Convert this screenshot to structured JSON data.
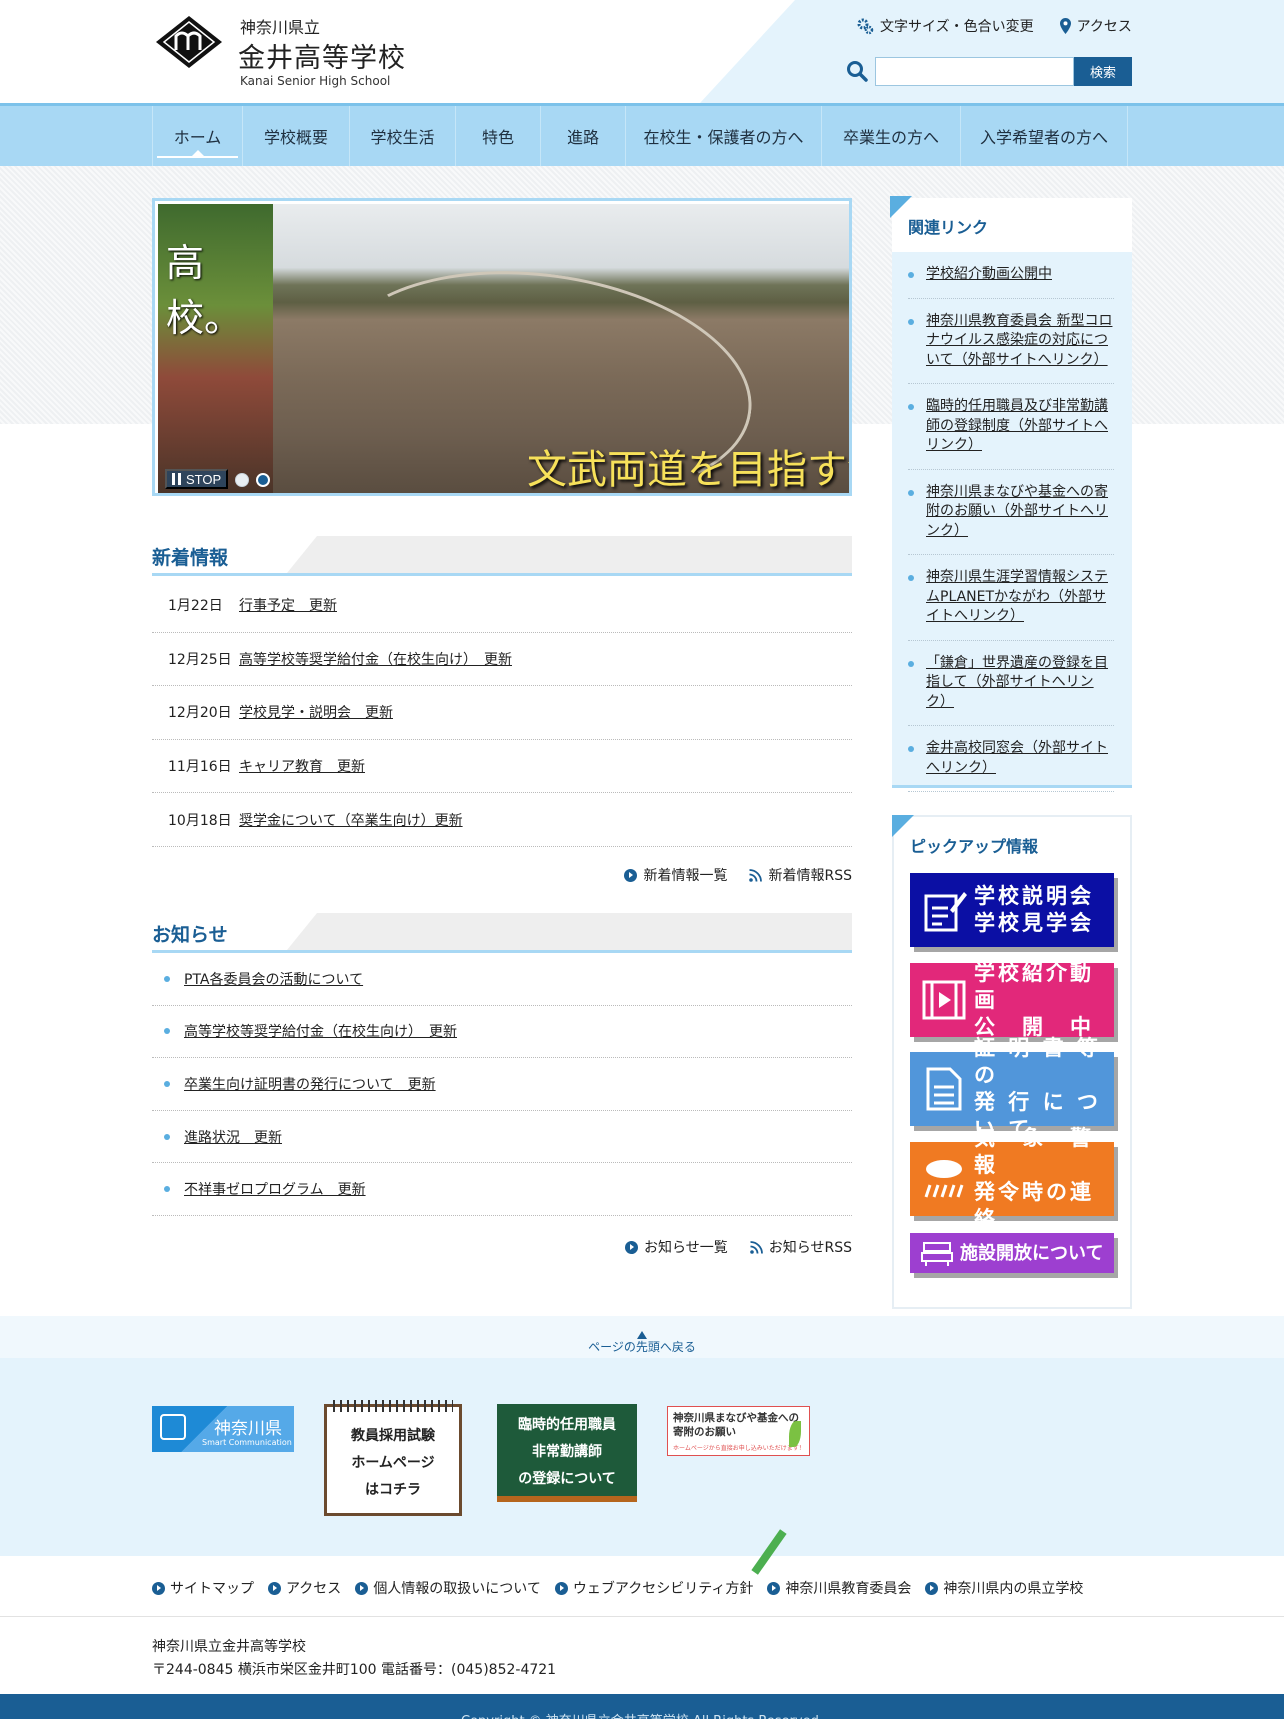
{
  "header": {
    "prefecture": "神奈川県立",
    "school_name": "金井高等学校",
    "school_name_en": "Kanai Senior High School",
    "util_links": [
      {
        "label": "文字サイズ・色合い変更",
        "icon": "gears-icon"
      },
      {
        "label": "アクセス",
        "icon": "map-pin-icon"
      }
    ],
    "search": {
      "placeholder": "",
      "button_label": "検索"
    }
  },
  "nav": {
    "items": [
      {
        "label": "ホーム",
        "active": true
      },
      {
        "label": "学校概要"
      },
      {
        "label": "学校生活"
      },
      {
        "label": "特色"
      },
      {
        "label": "進路"
      },
      {
        "label": "在校生・保護者の方へ"
      },
      {
        "label": "卒業生の方へ"
      },
      {
        "label": "入学希望者の方へ"
      }
    ]
  },
  "slider": {
    "left_text": "高校。",
    "caption": "文武両道を目指す金井",
    "stop_label": "STOP",
    "slide_count": 2,
    "active_slide": 2
  },
  "news": {
    "title": "新着情報",
    "items": [
      {
        "date": "1月22日",
        "title": "行事予定　更新"
      },
      {
        "date": "12月25日",
        "title": "高等学校等奨学給付金（在校生向け）　更新"
      },
      {
        "date": "12月20日",
        "title": "学校見学・説明会　更新"
      },
      {
        "date": "11月16日",
        "title": "キャリア教育　更新"
      },
      {
        "date": "10月18日",
        "title": "奨学金について（卒業生向け）更新"
      }
    ],
    "list_link": "新着情報一覧",
    "rss_link": "新着情報RSS"
  },
  "notices": {
    "title": "お知らせ",
    "items": [
      "PTA各委員会の活動について",
      "高等学校等奨学給付金（在校生向け）　更新",
      "卒業生向け証明書の発行について　更新",
      "進路状況　更新",
      "不祥事ゼロプログラム　更新"
    ],
    "list_link": "お知らせ一覧",
    "rss_link": "お知らせRSS"
  },
  "related": {
    "title": "関連リンク",
    "items": [
      "学校紹介動画公開中",
      "神奈川県教育委員会 新型コロナウイルス感染症の対応について（外部サイトへリンク）",
      "臨時的任用職員及び非常勤講師の登録制度（外部サイトへリンク）",
      "神奈川県まなびや基金への寄附のお願い（外部サイトへリンク）",
      "神奈川県生涯学習情報システムPLANETかながわ（外部サイトへリンク）",
      "「鎌倉」世界遺産の登録を目指して（外部サイトへリンク）",
      "金井高校同窓会（外部サイトへリンク）"
    ]
  },
  "pickup": {
    "title": "ピックアップ情報",
    "items": [
      {
        "label": "学校説明会\n学校見学会",
        "color": "#0b0fa4",
        "icon": "form-icon"
      },
      {
        "label": "学校紹介動画\n公　開　中",
        "color": "#e2287a",
        "icon": "film-icon"
      },
      {
        "label": "証 明 書 等 の\n発 行 に つ い て",
        "color": "#5196da",
        "icon": "document-icon"
      },
      {
        "label": "気　象　警　報\n発令時の連絡",
        "color": "#f07a22",
        "icon": "storm-icon"
      },
      {
        "label": "施設開放について",
        "color": "#9d3fd0",
        "icon": "building-icon"
      }
    ]
  },
  "pagetop": {
    "label": "ページの先頭へ戻る"
  },
  "banners": {
    "kanagawa": {
      "title": "神奈川県",
      "sub": "Smart Communication"
    },
    "saiyo": {
      "text": "教員採用試験\nホームページ\nはコチラ"
    },
    "rinji": {
      "text": "臨時的任用職員\n非常勤講師\nの登録について"
    },
    "manabi": {
      "text": "神奈川県まなびや基金への\n寄附のお願い",
      "sub": "ホームページから直接お申し込みいただけます！"
    }
  },
  "footer": {
    "links": [
      "サイトマップ",
      "アクセス",
      "個人情報の取扱いについて",
      "ウェブアクセシビリティ方針",
      "神奈川県教育委員会",
      "神奈川県内の県立学校"
    ],
    "address_name": "神奈川県立金井高等学校",
    "address_line": "〒244-0845 横浜市栄区金井町100 電話番号：(045)852-4721",
    "copyright": "Copyright © 神奈川県立金井高等学校 All Rights Reserved."
  }
}
